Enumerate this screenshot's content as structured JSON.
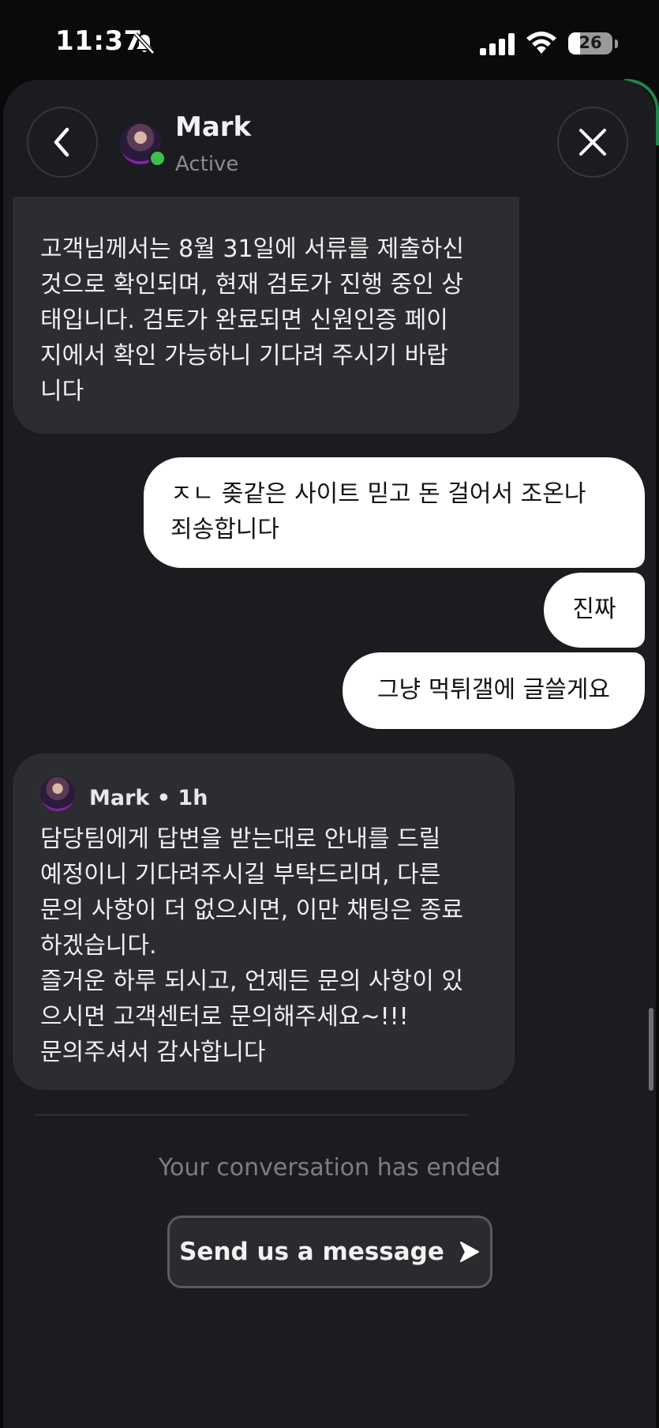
{
  "status_bar": {
    "time": "11:37",
    "battery": "26",
    "battery_level": 0.26,
    "icons": [
      "bell-slash-icon",
      "cellular-signal-icon",
      "wifi-icon",
      "battery-icon"
    ]
  },
  "header": {
    "name": "Mark",
    "status": "Active",
    "back_icon": "chevron-left-icon",
    "close_icon": "close-icon"
  },
  "messages": [
    {
      "direction": "incoming",
      "text": "고객님께서는 8월 31일에 서류를 제출하신\n것으로 확인되며, 현재 검토가 진행 중인 상\n태입니다. 검토가 완료되면 신원인증 페이\n지에서 확인 가능하니 기다려 주시기 바랍\n니다"
    },
    {
      "direction": "outgoing",
      "text": "ㅈㄴ 좆같은 사이트 믿고 돈 걸어서 조온나\n죄송합니다"
    },
    {
      "direction": "outgoing",
      "text": "진짜"
    },
    {
      "direction": "outgoing",
      "text": "그냥 먹튀갤에 글쓸게요"
    },
    {
      "direction": "incoming",
      "author": "Mark • 1h",
      "text": "담당팀에게 답변을 받는대로 안내를 드릴\n예정이니 기다려주시길 부탁드리며, 다른\n문의 사항이 더 없으시면, 이만 채팅은 종료\n하겠습니다.\n즐거운 하루 되시고, 언제든 문의 사항이 있\n으시면 고객센터로 문의해주세요~!!!\n문의주셔서 감사합니다"
    }
  ],
  "footer": {
    "ended_text": "Your conversation has ended",
    "send_button_label": "Send us a message",
    "send_icon": "arrow-right-icon"
  },
  "colors": {
    "sheet_bg": "#1b1c1f",
    "incoming_bubble": "#2c2d31",
    "outgoing_bubble": "#ffffff",
    "online": "#3fbf4a"
  }
}
